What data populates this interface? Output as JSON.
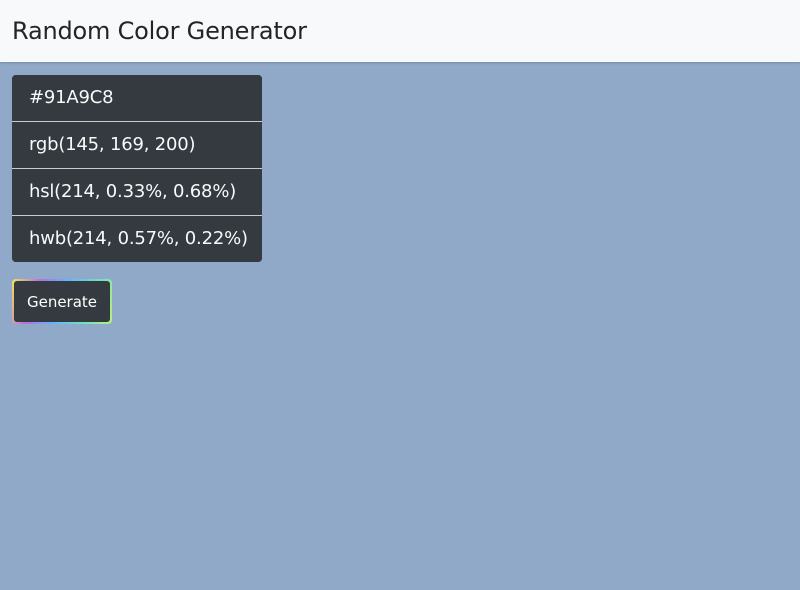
{
  "header": {
    "title": "Random Color Generator"
  },
  "color_values": [
    {
      "label": "#91A9C8"
    },
    {
      "label": "rgb(145, 169, 200)"
    },
    {
      "label": "hsl(214, 0.33%, 0.68%)"
    },
    {
      "label": "hwb(214, 0.57%, 0.22%)"
    }
  ],
  "controls": {
    "generate_label": "Generate"
  },
  "colors": {
    "background": "#91A9C8",
    "panel": "#343A40",
    "navbar": "#F8F9FA"
  }
}
